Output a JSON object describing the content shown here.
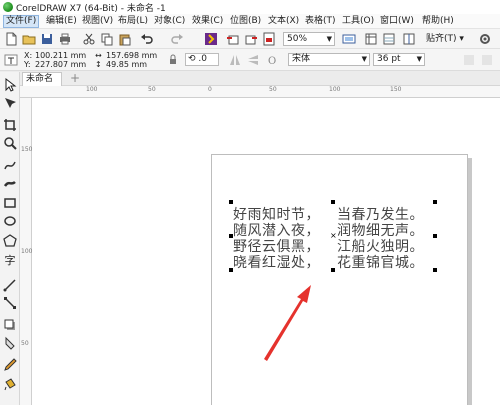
{
  "window": {
    "title": "CorelDRAW X7 (64-Bit) - 未命名 -1"
  },
  "menu": [
    "文件(F)",
    "编辑(E)",
    "视图(V)",
    "布局(L)",
    "对象(C)",
    "效果(C)",
    "位图(B)",
    "文本(X)",
    "表格(T)",
    "工具(O)",
    "窗口(W)",
    "帮助(H)"
  ],
  "toolbar": {
    "zoom": "50%",
    "snap_label": "贴齐(T)"
  },
  "propbar": {
    "x_label": "X:",
    "x_value": "100.211 mm",
    "y_label": "Y:",
    "y_value": "227.807 mm",
    "w_value": "157.698 mm",
    "h_value": "49.85 mm",
    "rotation": ".0",
    "font": "宋体",
    "font_size": "36 pt"
  },
  "document": {
    "tab": "未命名 -1",
    "add_tab": "+"
  },
  "ruler": {
    "h_ticks": [
      "100",
      "50",
      "0",
      "50",
      "100",
      "150"
    ],
    "v_ticks": [
      "150",
      "100",
      "50"
    ]
  },
  "poem": {
    "left_lines": [
      "好雨知时节，",
      "随风潜入夜，",
      "野径云俱黑，",
      "晓看红湿处，"
    ],
    "right_lines": [
      "当春乃发生。",
      "润物细无声。",
      "江船火独明。",
      "花重锦官城。"
    ]
  },
  "annotation": {
    "arrow_color": "#e5322d"
  }
}
